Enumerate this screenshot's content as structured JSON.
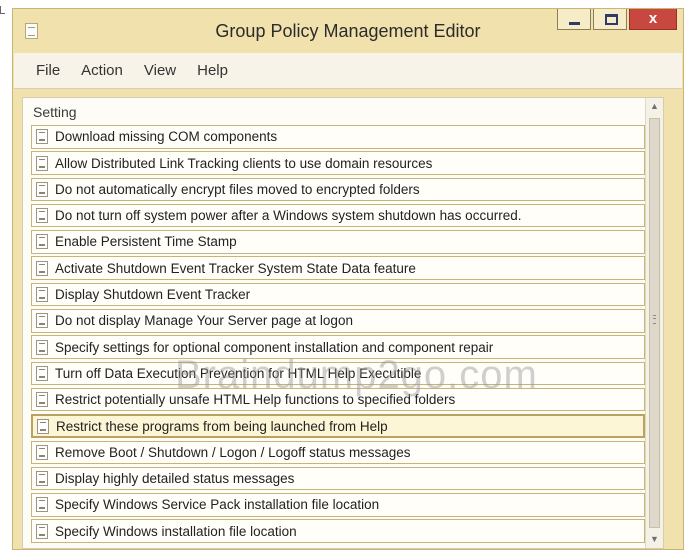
{
  "window": {
    "title": "Group Policy Management Editor",
    "close_label": "x",
    "accent_color": "#f1e1ad",
    "close_color": "#c8483f"
  },
  "menu": {
    "items": [
      "File",
      "Action",
      "View",
      "Help"
    ]
  },
  "list": {
    "column_header": "Setting",
    "rows": [
      {
        "label": "Download missing COM components",
        "selected": false
      },
      {
        "label": "Allow Distributed Link Tracking clients to use domain resources",
        "selected": false
      },
      {
        "label": "Do not automatically encrypt files moved to encrypted folders",
        "selected": false
      },
      {
        "label": "Do not turn off system power after a Windows system shutdown has occurred.",
        "selected": false
      },
      {
        "label": "Enable Persistent Time Stamp",
        "selected": false
      },
      {
        "label": "Activate Shutdown Event Tracker System State Data feature",
        "selected": false
      },
      {
        "label": "Display Shutdown Event Tracker",
        "selected": false
      },
      {
        "label": "Do not display Manage Your Server page at logon",
        "selected": false
      },
      {
        "label": "Specify settings for optional component installation and component repair",
        "selected": false
      },
      {
        "label": "Turn off Data Execution Prevention for HTML Help Executible",
        "selected": false
      },
      {
        "label": "Restrict potentially unsafe HTML Help functions to specified folders",
        "selected": false
      },
      {
        "label": "Restrict these programs from being launched from Help",
        "selected": true
      },
      {
        "label": "Remove Boot / Shutdown / Logon / Logoff status messages",
        "selected": false
      },
      {
        "label": "Display highly detailed status messages",
        "selected": false
      },
      {
        "label": "Specify Windows Service Pack installation file location",
        "selected": false
      },
      {
        "label": "Specify Windows installation file location",
        "selected": false
      }
    ]
  },
  "watermark": "Braindump2go.com",
  "icons": {
    "app": "gpo-document-icon",
    "row": "policy-setting-icon",
    "scroll_up": "chevron-up-icon",
    "scroll_down": "chevron-down-icon",
    "grip": "scroll-grip-icon"
  }
}
